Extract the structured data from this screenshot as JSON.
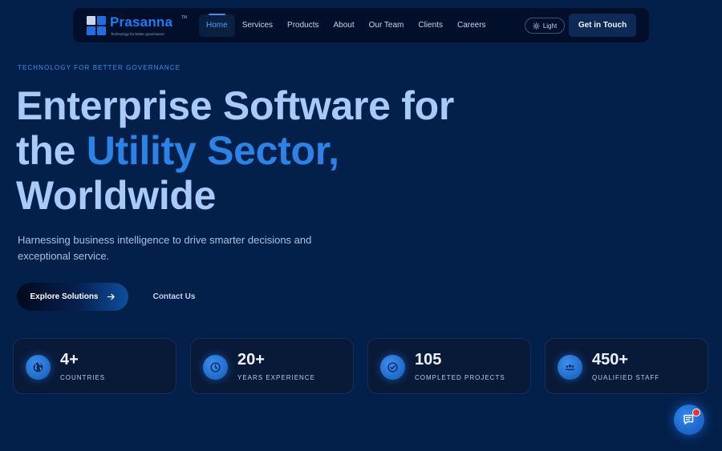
{
  "brand": {
    "name": "Prasanna",
    "trademark": "TM",
    "tagline": "Technology for better governance",
    "colors": {
      "background": "#03204a",
      "nav": "#020f2a",
      "accent": "#2d82e6",
      "headline": "#a8caf9"
    }
  },
  "nav": {
    "items": [
      {
        "label": "Home",
        "active": true
      },
      {
        "label": "Services"
      },
      {
        "label": "Products"
      },
      {
        "label": "About"
      },
      {
        "label": "Our Team"
      },
      {
        "label": "Clients"
      },
      {
        "label": "Careers"
      }
    ],
    "theme_toggle": {
      "label": "Light",
      "icon": "sun-icon"
    },
    "cta_label": "Get in Touch"
  },
  "hero": {
    "eyebrow": "TECHNOLOGY FOR BETTER GOVERNANCE",
    "headline": {
      "part1": "Enterprise Software for",
      "part2": "the",
      "accent": "Utility Sector,",
      "part3": "Worldwide"
    },
    "subtitle": "Harnessing business intelligence to drive smarter decisions and exceptional service.",
    "primary_button": {
      "label": "Explore Solutions",
      "icon": "arrow-right-icon"
    },
    "secondary_button": {
      "label": "Contact Us"
    }
  },
  "stats": [
    {
      "value": "4+",
      "label": "COUNTRIES",
      "icon": "globe-icon"
    },
    {
      "value": "20+",
      "label": "YEARS EXPERIENCE",
      "icon": "clock-icon"
    },
    {
      "value": "105",
      "label": "COMPLETED PROJECTS",
      "icon": "check-circle-icon"
    },
    {
      "value": "450+",
      "label": "QUALIFIED STAFF",
      "icon": "team-icon"
    }
  ],
  "chat": {
    "icon": "chat-icon",
    "has_notification": true
  }
}
